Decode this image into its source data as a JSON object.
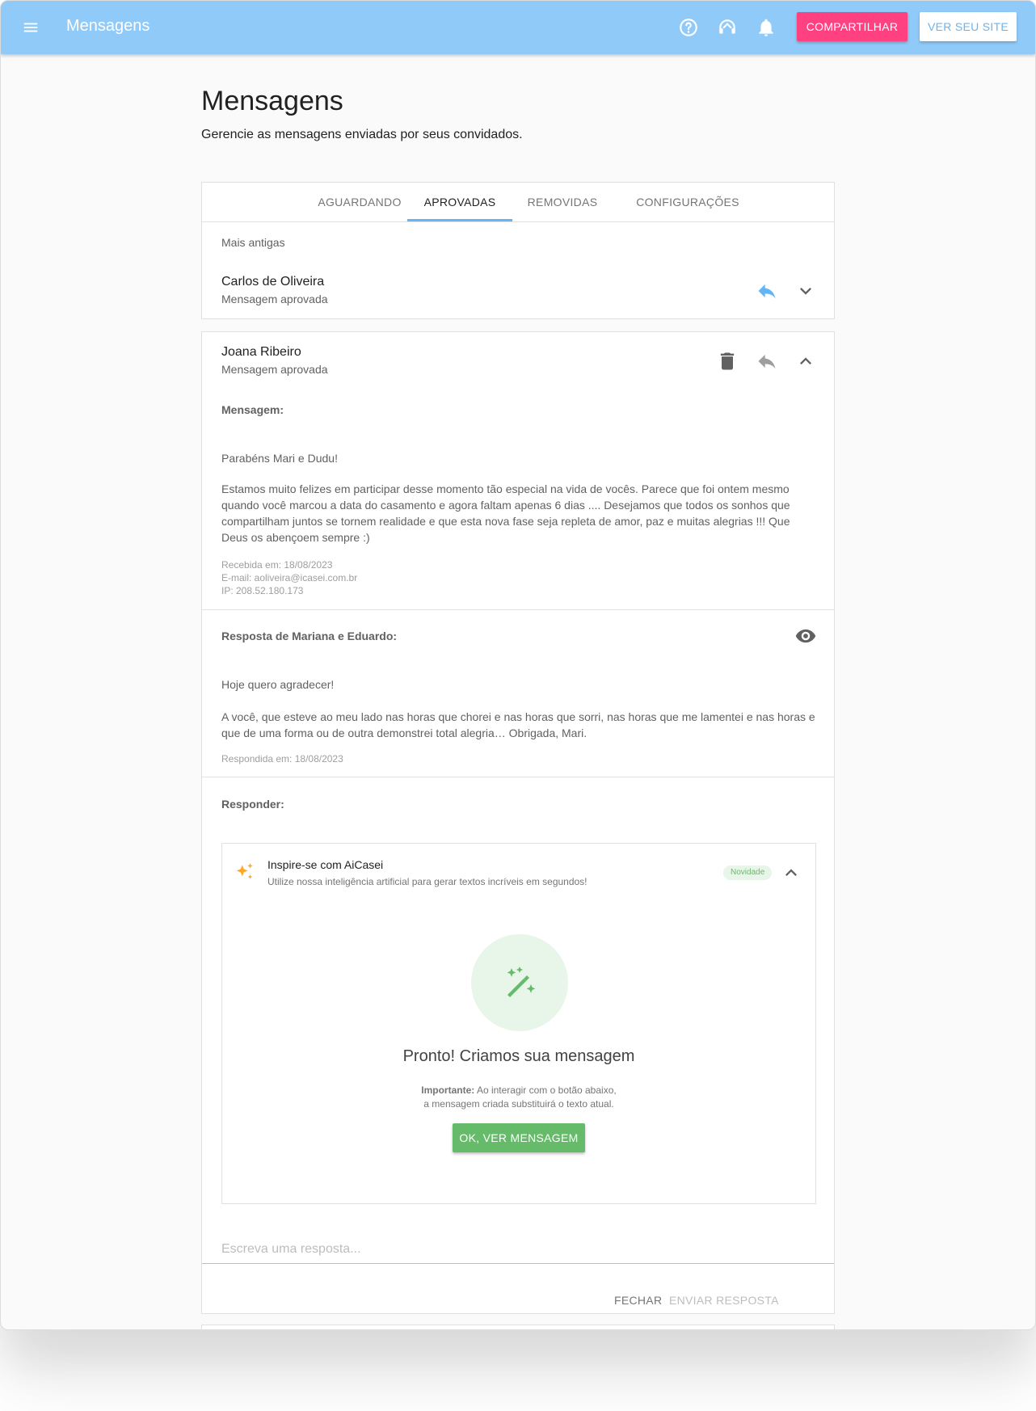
{
  "topbar": {
    "menu_icon": "menu-icon",
    "title": "Mensagens",
    "icons": [
      "help-icon",
      "support-headset-icon",
      "notification-bell-icon"
    ],
    "share_label": "COMPARTILHAR",
    "site_label": "VER SEU SITE",
    "color": "#90caf9",
    "share_color": "#ff4081"
  },
  "page": {
    "title": "Mensagens",
    "subtitle": "Gerencie as mensagens enviadas por seus convidados."
  },
  "tabs": [
    {
      "label": "AGUARDANDO",
      "active": false
    },
    {
      "label": "APROVADAS",
      "active": true
    },
    {
      "label": "REMOVIDAS",
      "active": false
    },
    {
      "label": "CONFIGURAÇÕES",
      "active": false
    }
  ],
  "sort_label": "Mais antigas",
  "messages": [
    {
      "name": "Carlos de Oliveira",
      "status": "Mensagem aprovada"
    },
    {
      "name": "Joana Ribeiro",
      "status": "Mensagem aprovada",
      "message_label": "Mensagem:",
      "greeting": "Parabéns Mari e Dudu!",
      "body": "Estamos muito felizes em participar desse momento tão especial na vida de vocês. Parece que foi ontem mesmo quando você marcou a data do casamento e agora faltam apenas 6 dias .... Desejamos que todos os sonhos que compartilham juntos se tornem realidade e que esta nova fase seja repleta de amor, paz e muitas alegrias !!! Que Deus os abençoem sempre :)",
      "received": "Recebida em: 18/08/2023",
      "email": "E-mail: aoliveira@icasei.com.br",
      "ip": "IP: 208.52.180.173",
      "response_label": "Resposta de Mariana e Eduardo:",
      "response_greeting": "Hoje quero agradecer!",
      "response_body": "A você, que esteve ao meu lado nas horas que chorei e nas horas que sorri, nas horas que me lamentei e nas horas e que de uma forma ou de outra demonstrei total alegria… Obrigada, Mari.",
      "responded": "Respondida em: 18/08/2023",
      "reply_label": "Responder:"
    }
  ],
  "ai": {
    "title": "Inspire-se com AiCasei",
    "subtitle": "Utilize nossa inteligência artificial para gerar textos incríveis em segundos!",
    "badge": "Novidade",
    "ready_title": "Pronto! Criamos sua mensagem",
    "note_bold": "Importante:",
    "note_line1": " Ao interagir com o botão abaixo,",
    "note_line2": "a mensagem criada substituirá o texto atual.",
    "button": "OK, VER MENSAGEM",
    "accent": "#66bb6a",
    "sparkle_color": "#ffa726"
  },
  "reply": {
    "placeholder": "Escreva uma resposta...",
    "close_label": "FECHAR",
    "send_label": "ENVIAR RESPOSTA"
  }
}
